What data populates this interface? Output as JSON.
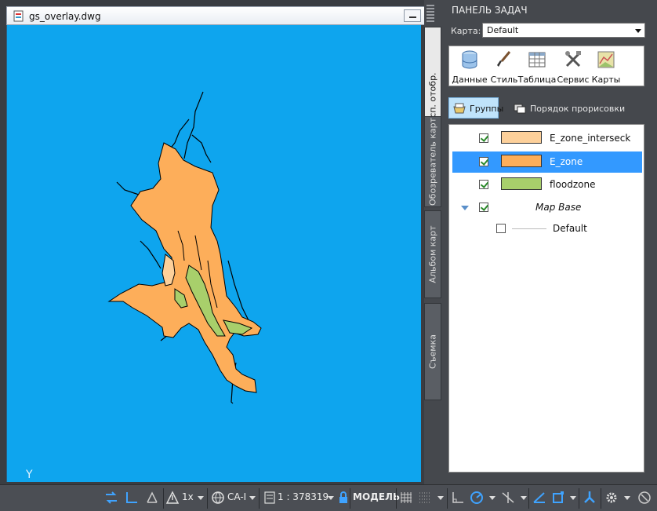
{
  "document": {
    "title": "gs_overlay.dwg",
    "ucs_label": "Y"
  },
  "palette": {
    "title": "ПАНЕЛЬ ЗАДАЧ",
    "map_label": "Карта:",
    "map_value": "Default",
    "side_tabs": [
      "Дисп. отобр.",
      "Обозреватель карт",
      "Альбом карт",
      "Съемка"
    ],
    "tools": [
      {
        "label": "Данные",
        "icon": "database-icon"
      },
      {
        "label": "Стиль",
        "icon": "brush-icon"
      },
      {
        "label": "Таблица",
        "icon": "table-icon"
      },
      {
        "label": "Сервис",
        "icon": "tools-icon"
      },
      {
        "label": "Карты",
        "icon": "map-icon"
      }
    ],
    "groups_label": "Группы",
    "draw_order_label": "Порядок прорисовки",
    "layers": [
      {
        "name": "E_zone_interseck",
        "color": "#fdd09a",
        "checked": true
      },
      {
        "name": "E_zone",
        "color": "#fdae5a",
        "checked": true,
        "selected": true
      },
      {
        "name": "floodzone",
        "color": "#a8cf6b",
        "checked": true
      }
    ],
    "base_group": {
      "name": "Map Base",
      "checked": true
    },
    "base_layer": {
      "name": "Default",
      "checked": false
    }
  },
  "statusbar": {
    "scale_factor": "1x",
    "coord_system": "CA-I",
    "map_scale": "1 : 378319",
    "space": "МОДЕЛЬ"
  },
  "colors": {
    "canvas": "#0ea5ee",
    "e_zone": "#fdae5a",
    "floodzone": "#a8cf6b",
    "selection": "#3399ff"
  }
}
